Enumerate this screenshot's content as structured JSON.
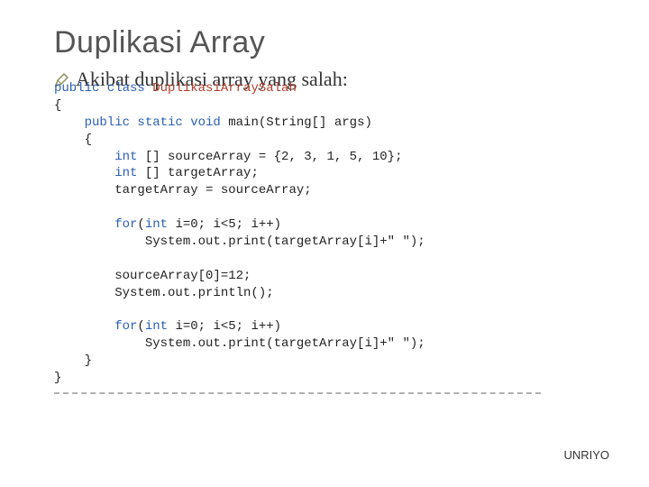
{
  "title": "Duplikasi Array",
  "bullet": "Akibat duplikasi array yang salah:",
  "code": {
    "l01a": "public class",
    "l01b": " DuplikasiArraySalah",
    "l02": "{",
    "l03a": "    public static void",
    "l03b": " main(String[] args)",
    "l04": "    {",
    "l05a": "        int",
    "l05b": " [] sourceArray = {2, 3, 1, 5, 10};",
    "l06a": "        int",
    "l06b": " [] targetArray;",
    "l07": "        targetArray = sourceArray;",
    "l08": "",
    "l09a": "        for",
    "l09b": "(",
    "l09c": "int",
    "l09d": " i=0; i<5; i++)",
    "l10": "            System.out.print(targetArray[i]+\" \");",
    "l11": "",
    "l12": "        sourceArray[0]=12;",
    "l13": "        System.out.println();",
    "l14": "",
    "l15a": "        for",
    "l15b": "(",
    "l15c": "int",
    "l15d": " i=0; i<5; i++)",
    "l16": "            System.out.print(targetArray[i]+\" \");",
    "l17": "    }",
    "l18": "}"
  },
  "footer": "UNRIYO"
}
